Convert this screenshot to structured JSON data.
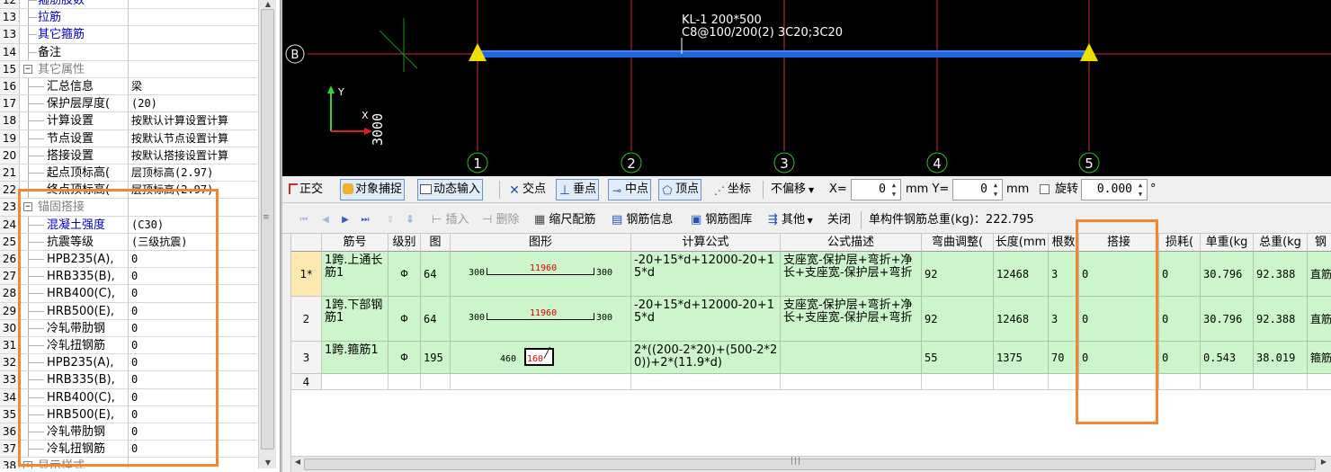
{
  "properties": {
    "rows": [
      {
        "num": "12",
        "name": "箍筋肢数",
        "value": "",
        "kind": "link",
        "depth": 1
      },
      {
        "num": "13",
        "name": "拉筋",
        "value": "",
        "kind": "link",
        "depth": 1
      },
      {
        "num": "13",
        "name": "其它箍筋",
        "value": "",
        "kind": "link",
        "depth": 1
      },
      {
        "num": "14",
        "name": "备注",
        "value": "",
        "kind": "plain",
        "depth": 1
      },
      {
        "num": "15",
        "name": "其它属性",
        "value": "",
        "kind": "group",
        "depth": 0,
        "expander": "−"
      },
      {
        "num": "16",
        "name": "汇总信息",
        "value": "梁",
        "kind": "plain",
        "depth": 2
      },
      {
        "num": "17",
        "name": "保护层厚度(",
        "value": "(20)",
        "kind": "plain",
        "depth": 2
      },
      {
        "num": "18",
        "name": "计算设置",
        "value": "按默认计算设置计算",
        "kind": "plain",
        "depth": 2
      },
      {
        "num": "19",
        "name": "节点设置",
        "value": "按默认节点设置计算",
        "kind": "plain",
        "depth": 2
      },
      {
        "num": "20",
        "name": "搭接设置",
        "value": "按默认搭接设置计算",
        "kind": "plain",
        "depth": 2
      },
      {
        "num": "21",
        "name": "起点顶标高(",
        "value": "层顶标高(2.97)",
        "kind": "plain",
        "depth": 2
      },
      {
        "num": "22",
        "name": "终点顶标高(",
        "value": "层顶标高(2.97)",
        "kind": "plain",
        "depth": 2
      },
      {
        "num": "23",
        "name": "锚固搭接",
        "value": "",
        "kind": "group",
        "depth": 0,
        "expander": "−"
      },
      {
        "num": "24",
        "name": "混凝土强度",
        "value": "(C30)",
        "kind": "link",
        "depth": 2
      },
      {
        "num": "25",
        "name": "抗震等级",
        "value": "(三级抗震)",
        "kind": "plain",
        "depth": 2
      },
      {
        "num": "26",
        "name": "HPB235(A),",
        "value": "0",
        "kind": "plain",
        "depth": 2
      },
      {
        "num": "27",
        "name": "HRB335(B),",
        "value": "0",
        "kind": "plain",
        "depth": 2
      },
      {
        "num": "28",
        "name": "HRB400(C),",
        "value": "0",
        "kind": "plain",
        "depth": 2
      },
      {
        "num": "29",
        "name": "HRB500(E),",
        "value": "0",
        "kind": "plain",
        "depth": 2
      },
      {
        "num": "30",
        "name": "冷轧带肋钢",
        "value": "0",
        "kind": "plain",
        "depth": 2
      },
      {
        "num": "31",
        "name": "冷轧扭钢筋",
        "value": "0",
        "kind": "plain",
        "depth": 2
      },
      {
        "num": "32",
        "name": "HPB235(A),",
        "value": "0",
        "kind": "plain",
        "depth": 2
      },
      {
        "num": "33",
        "name": "HRB335(B),",
        "value": "0",
        "kind": "plain",
        "depth": 2
      },
      {
        "num": "34",
        "name": "HRB400(C),",
        "value": "0",
        "kind": "plain",
        "depth": 2
      },
      {
        "num": "35",
        "name": "HRB500(E),",
        "value": "0",
        "kind": "plain",
        "depth": 2
      },
      {
        "num": "36",
        "name": "冷轧带肋钢",
        "value": "0",
        "kind": "plain",
        "depth": 2
      },
      {
        "num": "37",
        "name": "冷轧扭钢筋",
        "value": "0",
        "kind": "plain",
        "depth": 2
      },
      {
        "num": "38",
        "name": "显示样式",
        "value": "",
        "kind": "group",
        "depth": 0,
        "expander": "+"
      }
    ]
  },
  "canvas": {
    "beam_label_1": "KL-1 200*500",
    "beam_label_2": "C8@100/200(2) 3C20;3C20",
    "axis_row": "B",
    "axis_cols": [
      "1",
      "2",
      "3",
      "4",
      "5"
    ],
    "ucs_y": "Y",
    "ucs_x": "X",
    "dimension": "3000",
    "colors": {
      "beam": "#1e66e0",
      "grid_line": "#d2283c",
      "axis_circle": "#22c822",
      "support": "#f0e000"
    }
  },
  "toolbar": {
    "orthogonal": "正交",
    "snap": "对象捕捉",
    "dynamic_input": "动态输入",
    "intersection": "交点",
    "perpendicular": "垂点",
    "midpoint": "中点",
    "vertex": "顶点",
    "coordinate": "坐标",
    "offset": "不偏移",
    "x_label": "X=",
    "x_value": "0",
    "y_label": "mm Y=",
    "y_value": "0",
    "mm": "mm",
    "rotate": "旋转",
    "rotate_value": "0.000",
    "degree": "°"
  },
  "rebar_toolbar": {
    "insert": "插入",
    "delete": "删除",
    "scale_rebar": "缩尺配筋",
    "rebar_info": "钢筋信息",
    "rebar_library": "钢筋图库",
    "other": "其他",
    "close": "关闭",
    "total_weight": "单构件钢筋总重(kg)：222.795"
  },
  "grid": {
    "headers": [
      "筋号",
      "级别",
      "图",
      "图形",
      "计算公式",
      "公式描述",
      "弯曲调整(",
      "长度(mm",
      "根数",
      "搭接",
      "损耗(",
      "单重(kg",
      "总重(kg",
      "钢"
    ],
    "rows": [
      {
        "row_label": "1*",
        "name": "1跨.上通长筋1",
        "grade": "Φ",
        "shape_no": "64",
        "shape": {
          "left": "300",
          "mid": "11960",
          "right": "300"
        },
        "formula": "-20+15*d+12000-20+15*d",
        "desc": "支座宽-保护层+弯折+净长+支座宽-保护层+弯折",
        "bend": "92",
        "length": "12468",
        "count": "3",
        "lap": "0",
        "loss": "0",
        "unit_weight": "30.796",
        "total_weight": "92.388",
        "extra": "直筋"
      },
      {
        "row_label": "2",
        "name": "1跨.下部钢筋1",
        "grade": "Φ",
        "shape_no": "64",
        "shape": {
          "left": "300",
          "mid": "11960",
          "right": "300"
        },
        "formula": "-20+15*d+12000-20+15*d",
        "desc": "支座宽-保护层+弯折+净长+支座宽-保护层+弯折",
        "bend": "92",
        "length": "12468",
        "count": "3",
        "lap": "0",
        "loss": "0",
        "unit_weight": "30.796",
        "total_weight": "92.388",
        "extra": "直筋"
      },
      {
        "row_label": "3",
        "name": "1跨.箍筋1",
        "grade": "Φ",
        "shape_no": "195",
        "shape": {
          "left": "460",
          "mid": "160",
          "right": ""
        },
        "formula": "2*((200-2*20)+(500-2*20))+2*(11.9*d)",
        "desc": "",
        "bend": "55",
        "length": "1375",
        "count": "70",
        "lap": "0",
        "loss": "0",
        "unit_weight": "0.543",
        "total_weight": "38.019",
        "extra": "箍筋"
      }
    ],
    "empty_row_label": "4"
  },
  "highlight_color": "#f5852f"
}
